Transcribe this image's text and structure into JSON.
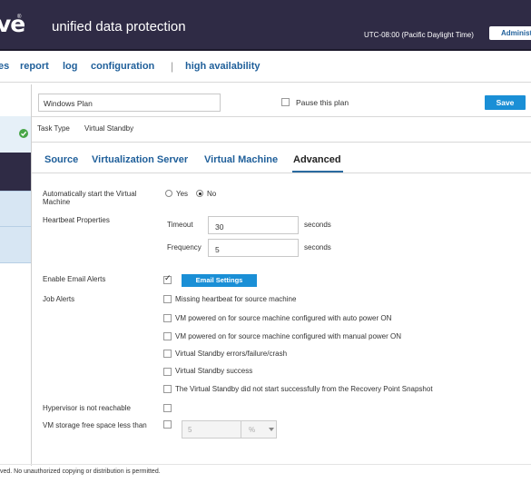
{
  "header": {
    "logo_text": "ve",
    "logo_mark": "®",
    "title": "unified data protection",
    "timezone": "UTC-08:00 (Pacific Daylight Time)",
    "user_button": "Administrator"
  },
  "nav": {
    "items": [
      "es",
      "report",
      "log",
      "configuration",
      "high availability"
    ],
    "separator": "|"
  },
  "plan": {
    "name_value": "Windows Plan",
    "pause_label": "Pause this plan",
    "pause_checked": false,
    "save_label": "Save",
    "task_type_label": "Task Type",
    "task_type_value": "Virtual Standby"
  },
  "tabs": [
    {
      "label": "Source",
      "active": false
    },
    {
      "label": "Virtualization Server",
      "active": false
    },
    {
      "label": "Virtual Machine",
      "active": false
    },
    {
      "label": "Advanced",
      "active": true
    }
  ],
  "advanced": {
    "auto_start_label": "Automatically start the Virtual Machine",
    "auto_start_line1": "Automatically start the Virtual",
    "auto_start_line2": "Machine",
    "yes_label": "Yes",
    "no_label": "No",
    "auto_start_value": "No",
    "heartbeat_label": "Heartbeat Properties",
    "timeout_label": "Timeout",
    "timeout_value": "30",
    "timeout_unit": "seconds",
    "frequency_label": "Frequency",
    "frequency_value": "5",
    "frequency_unit": "seconds",
    "email_alerts_label": "Enable Email Alerts",
    "email_alerts_checked": true,
    "email_settings_button": "Email Settings",
    "job_alerts_label": "Job Alerts",
    "job_alerts": [
      {
        "label": "Missing heartbeat for source machine",
        "checked": false
      },
      {
        "label": "VM powered on for source machine configured with auto power ON",
        "checked": false
      },
      {
        "label": "VM powered on for source machine configured with manual power ON",
        "checked": false
      },
      {
        "label": "Virtual Standby errors/failure/crash",
        "checked": false
      },
      {
        "label": "Virtual Standby success",
        "checked": false
      },
      {
        "label": "The Virtual Standby did not start successfully from the Recovery Point Snapshot",
        "checked": false
      }
    ],
    "hypervisor_label": "Hypervisor is not reachable",
    "hypervisor_checked": false,
    "storage_label": "VM storage free space less than",
    "storage_checked": false,
    "storage_value": "5",
    "storage_unit": "%"
  },
  "footer": {
    "text": "ved. No unauthorized copying or distribution is permitted."
  },
  "colors": {
    "header_bg": "#2f2b45",
    "link_blue": "#1f5f9a",
    "button_blue": "#1a8fd6",
    "sidebar_light": "#d7e6f3",
    "success_green": "#47a547"
  }
}
